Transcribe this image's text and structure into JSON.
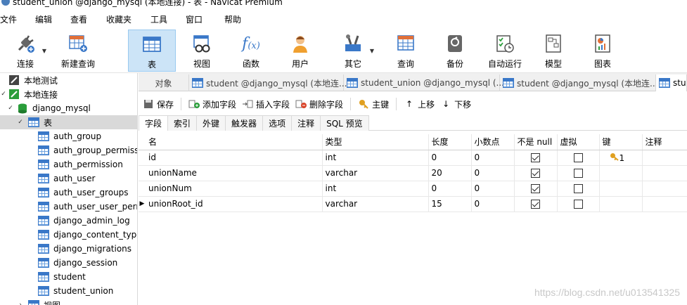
{
  "window": {
    "title": "student_union @django_mysql (本地连接) - 表 - Navicat Premium"
  },
  "menu": [
    "文件",
    "编辑",
    "查看",
    "收藏夹",
    "工具",
    "窗口",
    "帮助"
  ],
  "toolbar": [
    {
      "label": "连接",
      "icon": "plug-icon"
    },
    {
      "label": "新建查询",
      "icon": "new-query-icon"
    },
    {
      "label": "表",
      "icon": "table-icon",
      "active": true
    },
    {
      "label": "视图",
      "icon": "view-icon"
    },
    {
      "label": "函数",
      "icon": "function-icon"
    },
    {
      "label": "用户",
      "icon": "user-icon"
    },
    {
      "label": "其它",
      "icon": "tools-icon"
    },
    {
      "label": "查询",
      "icon": "query-icon"
    },
    {
      "label": "备份",
      "icon": "backup-icon"
    },
    {
      "label": "自动运行",
      "icon": "autorun-icon"
    },
    {
      "label": "模型",
      "icon": "model-icon"
    },
    {
      "label": "图表",
      "icon": "chart-icon"
    }
  ],
  "tree": {
    "items": [
      {
        "label": "本地测试",
        "level": 0
      },
      {
        "label": "本地连接",
        "level": 0
      },
      {
        "label": "django_mysql",
        "level": 1
      },
      {
        "label": "表",
        "level": 2
      },
      {
        "label": "auth_group",
        "level": 3
      },
      {
        "label": "auth_group_permiss",
        "level": 3
      },
      {
        "label": "auth_permission",
        "level": 3
      },
      {
        "label": "auth_user",
        "level": 3
      },
      {
        "label": "auth_user_groups",
        "level": 3
      },
      {
        "label": "auth_user_user_perm",
        "level": 3
      },
      {
        "label": "django_admin_log",
        "level": 3
      },
      {
        "label": "django_content_type",
        "level": 3
      },
      {
        "label": "django_migrations",
        "level": 3
      },
      {
        "label": "django_session",
        "level": 3
      },
      {
        "label": "student",
        "level": 3
      },
      {
        "label": "student_union",
        "level": 3
      },
      {
        "label": "视图",
        "level": 2
      }
    ]
  },
  "tabs": [
    {
      "label": "对象"
    },
    {
      "label": "student @django_mysql (本地连..."
    },
    {
      "label": "student_union @django_mysql (..."
    },
    {
      "label": "student @django_mysql (本地连..."
    },
    {
      "label": "stu"
    }
  ],
  "design_toolbar": {
    "save": "保存",
    "add_field": "添加字段",
    "insert_field": "插入字段",
    "delete_field": "删除字段",
    "primary_key": "主键",
    "move_up": "上移",
    "move_down": "下移"
  },
  "subtabs": [
    "字段",
    "索引",
    "外键",
    "触发器",
    "选项",
    "注释",
    "SQL 预览"
  ],
  "grid": {
    "headers": [
      "名",
      "类型",
      "长度",
      "小数点",
      "不是 null",
      "虚拟",
      "键",
      "注释"
    ],
    "rows": [
      {
        "name": "id",
        "type": "int",
        "length": "0",
        "decimals": "0",
        "not_null": true,
        "virtual": false,
        "key": "1"
      },
      {
        "name": "unionName",
        "type": "varchar",
        "length": "20",
        "decimals": "0",
        "not_null": true,
        "virtual": false,
        "key": ""
      },
      {
        "name": "unionNum",
        "type": "int",
        "length": "0",
        "decimals": "0",
        "not_null": true,
        "virtual": false,
        "key": ""
      },
      {
        "name": "unionRoot_id",
        "type": "varchar",
        "length": "15",
        "decimals": "0",
        "not_null": true,
        "virtual": false,
        "key": ""
      }
    ]
  },
  "watermark": "https://blog.csdn.net/u013541325",
  "colors": {
    "accent": "#3a78c8",
    "active_tool_bg": "#cce4f7",
    "selected_tree_bg": "#d9d9d9"
  }
}
